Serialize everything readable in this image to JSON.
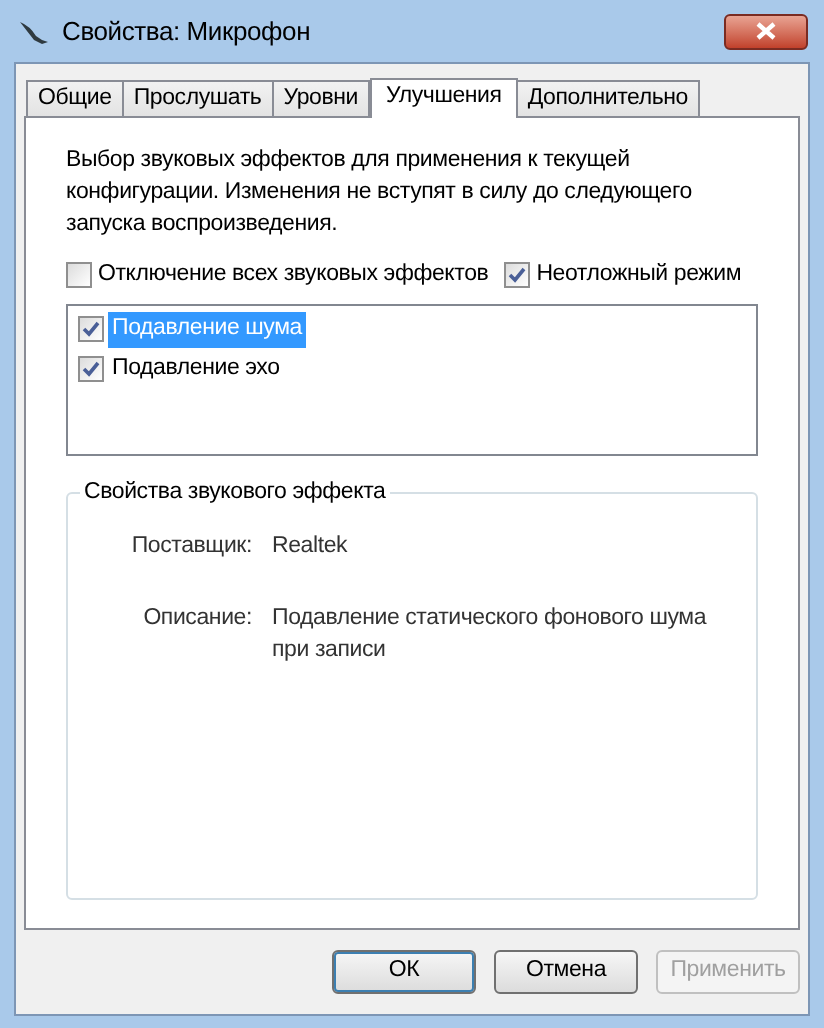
{
  "window": {
    "title": "Свойства: Микрофон"
  },
  "tabs": [
    {
      "label": "Общие",
      "selected": false
    },
    {
      "label": "Прослушать",
      "selected": false
    },
    {
      "label": "Уровни",
      "selected": false
    },
    {
      "label": "Улучшения",
      "selected": true
    },
    {
      "label": "Дополнительно",
      "selected": false
    }
  ],
  "intro": "Выбор звуковых эффектов для применения к текущей конфигурации. Изменения не вступят в силу до следующего запуска воспроизведения.",
  "options": [
    {
      "label": "Отключение всех звуковых эффектов",
      "checked": false
    },
    {
      "label": "Неотложный режим",
      "checked": true
    }
  ],
  "effects": [
    {
      "label": "Подавление шума",
      "checked": true,
      "selected": true
    },
    {
      "label": "Подавление эхо",
      "checked": true,
      "selected": false
    }
  ],
  "properties": {
    "title": "Свойства звукового эффекта",
    "rows": [
      {
        "label": "Поставщик:",
        "value": "Realtek"
      },
      {
        "label": "Описание:",
        "value": "Подавление статического фонового шума при записи"
      }
    ]
  },
  "buttons": [
    {
      "label": "ОК",
      "disabled": false,
      "default": true
    },
    {
      "label": "Отмена",
      "disabled": false,
      "default": false
    },
    {
      "label": "Применить",
      "disabled": true,
      "default": false
    }
  ]
}
